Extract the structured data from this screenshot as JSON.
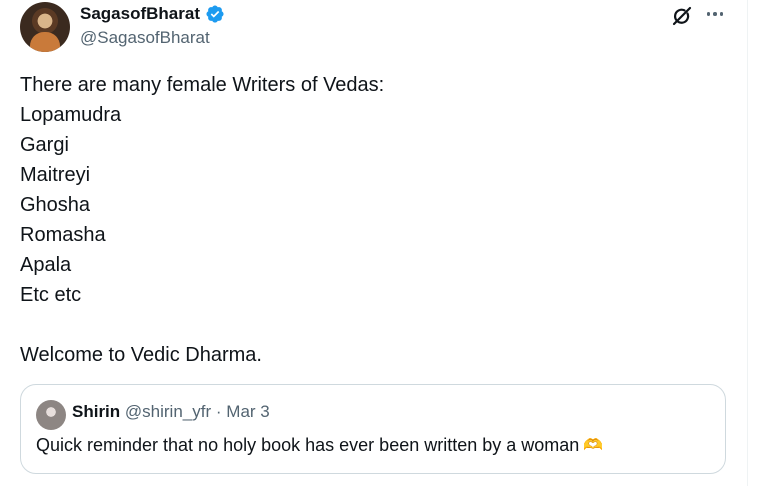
{
  "author": {
    "display_name": "SagasofBharat",
    "handle": "@SagasofBharat",
    "verified": true,
    "verified_color": "#1d9bf0"
  },
  "actions": {
    "grok_icon": "grok-icon",
    "more_icon": "more-icon"
  },
  "tweet": {
    "lines": [
      "There are many female Writers of Vedas:",
      "Lopamudra",
      "Gargi",
      "Maitreyi",
      "Ghosha",
      "Romasha",
      "Apala",
      "Etc etc",
      "",
      "Welcome to Vedic Dharma."
    ]
  },
  "quoted_tweet": {
    "display_name": "Shirin",
    "handle": "@shirin_yfr",
    "separator": "·",
    "date": "Mar 3",
    "text": "Quick reminder that no holy book has ever been written by a woman",
    "emoji": "🫶"
  },
  "colors": {
    "text_primary": "#0f1419",
    "text_secondary": "#536471",
    "border": "#cfd9de"
  }
}
